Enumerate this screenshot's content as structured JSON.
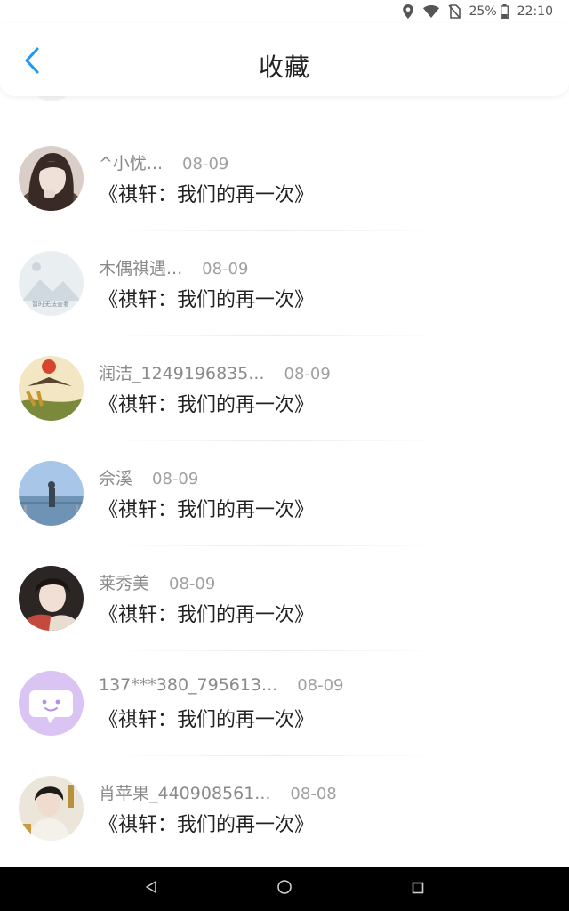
{
  "status_bar": {
    "battery": "25%",
    "time": "22:10"
  },
  "header": {
    "title": "收藏"
  },
  "items": [
    {
      "name": "^小忧...",
      "date": "08-09",
      "title": "《祺轩：我们的再一次》"
    },
    {
      "name": "木偶祺遇...",
      "date": "08-09",
      "title": "《祺轩：我们的再一次》",
      "avatar_text": "暂时无法查看"
    },
    {
      "name": "润洁_1249196835...",
      "date": "08-09",
      "title": "《祺轩：我们的再一次》"
    },
    {
      "name": "佘溪",
      "date": "08-09",
      "title": "《祺轩：我们的再一次》"
    },
    {
      "name": "莱秀美",
      "date": "08-09",
      "title": "《祺轩：我们的再一次》"
    },
    {
      "name": "137***380_795613...",
      "date": "08-09",
      "title": "《祺轩：我们的再一次》"
    },
    {
      "name": "肖苹果_440908561...",
      "date": "08-08",
      "title": "《祺轩：我们的再一次》"
    }
  ],
  "colors": {
    "accent": "#2196f3",
    "nav_bg": "#000000"
  }
}
